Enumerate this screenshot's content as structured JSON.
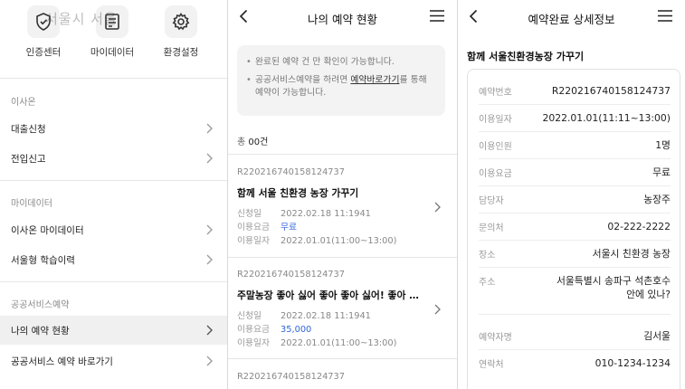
{
  "watermark": "서울시 서울",
  "panel1": {
    "icons": [
      {
        "label": "인증센터",
        "icon": "shield-check-icon"
      },
      {
        "label": "마이데이터",
        "icon": "document-icon"
      },
      {
        "label": "환경설정",
        "icon": "gear-icon"
      }
    ],
    "sections": [
      {
        "title": "이사온",
        "items": [
          "대출신청",
          "전입신고"
        ]
      },
      {
        "title": "마이데이터",
        "items": [
          "이사온 마이데이터",
          "서울형 학습이력"
        ]
      },
      {
        "title": "공공서비스예약",
        "items": [
          "나의 예약 현황",
          "공공서비스 예약 바로가기"
        ]
      }
    ],
    "active_item": "나의 예약 현황"
  },
  "panel2": {
    "title": "나의 예약 현황",
    "notice": {
      "line1": "완료된 예약 건 만 확인이 가능합니다.",
      "line2_pre": "공공서비스예약을 하려면 ",
      "line2_link": "예약바로가기",
      "line2_post": "를 통해 예약이 가능합니다."
    },
    "total_label": "총 ",
    "total_count": "00건",
    "labels": {
      "applied": "신청일",
      "fee": "이용요금",
      "date": "이용일자"
    },
    "cards": [
      {
        "id": "R220216740158124737",
        "title": "함께 서울 친환경 농장 가꾸기",
        "applied": "2022.02.18 11:1941",
        "fee": "무료",
        "date": "2022.01.01(11:00~13:00)"
      },
      {
        "id": "R220216740158124737",
        "title": "주말농장 좋아 싫어 좋아 좋아 싫어! 좋아 싫어",
        "applied": "2022.02.18 11:1941",
        "fee": "35,000",
        "date": "2022.01.01(11:00~13:00)"
      },
      {
        "id": "R220216740158124737"
      }
    ]
  },
  "panel3": {
    "title": "예약완료 상세정보",
    "program_title": "함께 서울친환경농장 가꾸기",
    "rows": [
      {
        "k": "예약번호",
        "v": "R220216740158124737"
      },
      {
        "k": "이용일자",
        "v": "2022.01.01(11:11~13:00)"
      },
      {
        "k": "이용인원",
        "v": "1명"
      },
      {
        "k": "이용요금",
        "v": "무료"
      },
      {
        "k": "담당자",
        "v": "농장주"
      },
      {
        "k": "문의처",
        "v": "02-222-2222"
      },
      {
        "k": "장소",
        "v": "서울시 친환경 농장"
      },
      {
        "k": "주소",
        "v": "서울특별시 송파구 석촌호수",
        "v2": "안에 있나?"
      },
      {
        "k": "예약자명",
        "v": "김서울"
      },
      {
        "k": "연락처",
        "v": "010-1234-1234"
      }
    ]
  },
  "colors": {
    "accent_blue": "#2f64d9",
    "active_bg": "#f0f0f0"
  }
}
